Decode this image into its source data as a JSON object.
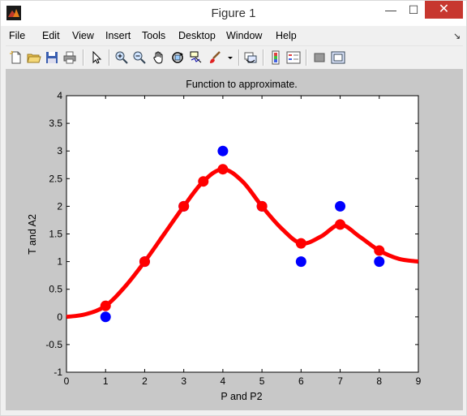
{
  "window": {
    "title": "Figure 1",
    "minimize": "—",
    "maximize": "☐",
    "close": "✕"
  },
  "menu": {
    "items": [
      "File",
      "Edit",
      "View",
      "Insert",
      "Tools",
      "Desktop",
      "Window",
      "Help"
    ]
  },
  "toolbar": {
    "icons": [
      "new-figure-icon",
      "open-file-icon",
      "save-icon",
      "print-icon",
      "edit-plot-arrow-icon",
      "zoom-in-icon",
      "zoom-out-icon",
      "pan-hand-icon",
      "rotate-3d-icon",
      "data-cursor-icon",
      "brush-icon",
      "link-plot-icon",
      "insert-colorbar-icon",
      "insert-legend-icon",
      "hide-plot-tools-icon",
      "show-plot-tools-icon"
    ]
  },
  "chart_data": {
    "type": "scatter",
    "title": "Function to approximate.",
    "xlabel": "P and P2",
    "ylabel": "T and A2",
    "xlim": [
      0,
      9
    ],
    "ylim": [
      -1,
      4
    ],
    "xticks": [
      "0",
      "1",
      "2",
      "3",
      "4",
      "5",
      "6",
      "7",
      "8",
      "9"
    ],
    "yticks": [
      "-1",
      "-0.5",
      "0",
      "0.5",
      "1",
      "1.5",
      "2",
      "2.5",
      "3",
      "3.5",
      "4"
    ],
    "grid": false,
    "series": [
      {
        "color": "#0000ff",
        "marker": "circle",
        "x": [
          1,
          2,
          3,
          4,
          5,
          6,
          7,
          8
        ],
        "y": [
          0,
          1,
          2,
          3,
          2,
          1,
          2,
          1
        ]
      },
      {
        "color": "#ff0000",
        "marker": "circle",
        "x": [
          1,
          2,
          3,
          3.5,
          4,
          5,
          6,
          7,
          8
        ],
        "y": [
          0.2,
          1.0,
          2.0,
          2.45,
          2.67,
          2.0,
          1.33,
          1.67,
          1.2
        ]
      },
      {
        "color": "#ff0000",
        "marker": "line",
        "x": [
          0,
          0.5,
          1,
          1.5,
          2,
          2.5,
          3,
          3.5,
          4,
          4.5,
          5,
          5.5,
          6,
          6.5,
          7,
          7.5,
          8,
          8.5,
          9
        ],
        "y": [
          0.0,
          0.05,
          0.2,
          0.55,
          1.0,
          1.5,
          2.0,
          2.45,
          2.67,
          2.45,
          2.0,
          1.6,
          1.33,
          1.45,
          1.67,
          1.45,
          1.2,
          1.05,
          1.0
        ]
      }
    ]
  }
}
